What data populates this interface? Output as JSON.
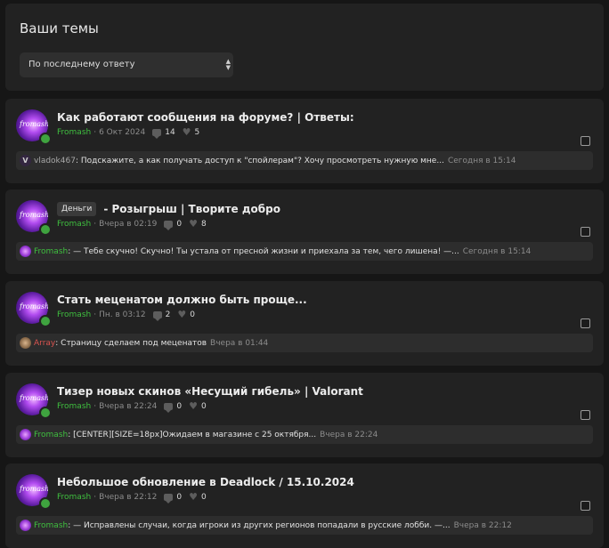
{
  "header": {
    "title": "Ваши темы",
    "sort_selected": "По последнему ответу"
  },
  "threads": [
    {
      "tag": "",
      "title": "Как работают сообщения на форуме? | Ответы:",
      "author": "Fromash",
      "date": "6 Окт 2024",
      "replies": "14",
      "likes": "5",
      "last_user": "vladok467",
      "last_text": "Подскажите, а как получать доступ к \"спойлерам\"? Хочу просмотреть нужную мне...",
      "last_time": "Сегодня в 15:14"
    },
    {
      "tag": "Деньги",
      "title": "- Розыгрыш | Творите добро",
      "author": "Fromash",
      "date": "Вчера в 02:19",
      "replies": "0",
      "likes": "8",
      "last_user": "Fromash",
      "last_text": "— Тебе скучно! Скучно! Ты устала от пресной жизни и приехала за тем, чего лишена! —...",
      "last_time": "Сегодня в 15:14"
    },
    {
      "tag": "",
      "title": "Стать меценатом должно быть проще...",
      "author": "Fromash",
      "date": "Пн. в 03:12",
      "replies": "2",
      "likes": "0",
      "last_user": "Array",
      "last_text": "Страницу сделаем под меценатов",
      "last_time": "Вчера в 01:44"
    },
    {
      "tag": "",
      "title": "Тизер новых скинов «Несущий гибель» | Valorant",
      "author": "Fromash",
      "date": "Вчера в 22:24",
      "replies": "0",
      "likes": "0",
      "last_user": "Fromash",
      "last_text": "[CENTER][SIZE=18px]Ожидаем в магазине с 25 октября...",
      "last_time": "Вчера в 22:24"
    },
    {
      "tag": "",
      "title": "Небольшое обновление в Deadlock / 15.10.2024",
      "author": "Fromash",
      "date": "Вчера в 22:12",
      "replies": "0",
      "likes": "0",
      "last_user": "Fromash",
      "last_text": "— Исправлены случаи, когда игроки из других регионов попадали в русские лобби. —...",
      "last_time": "Вчера в 22:12"
    }
  ],
  "avatar_text": "fromash",
  "avatar_letter_v": "V",
  "colors": {
    "author_green": "#3fbf3f",
    "online_green": "#3fa33f",
    "user_red": "#d9534f",
    "card_bg": "#222222",
    "page_bg": "#161616"
  }
}
